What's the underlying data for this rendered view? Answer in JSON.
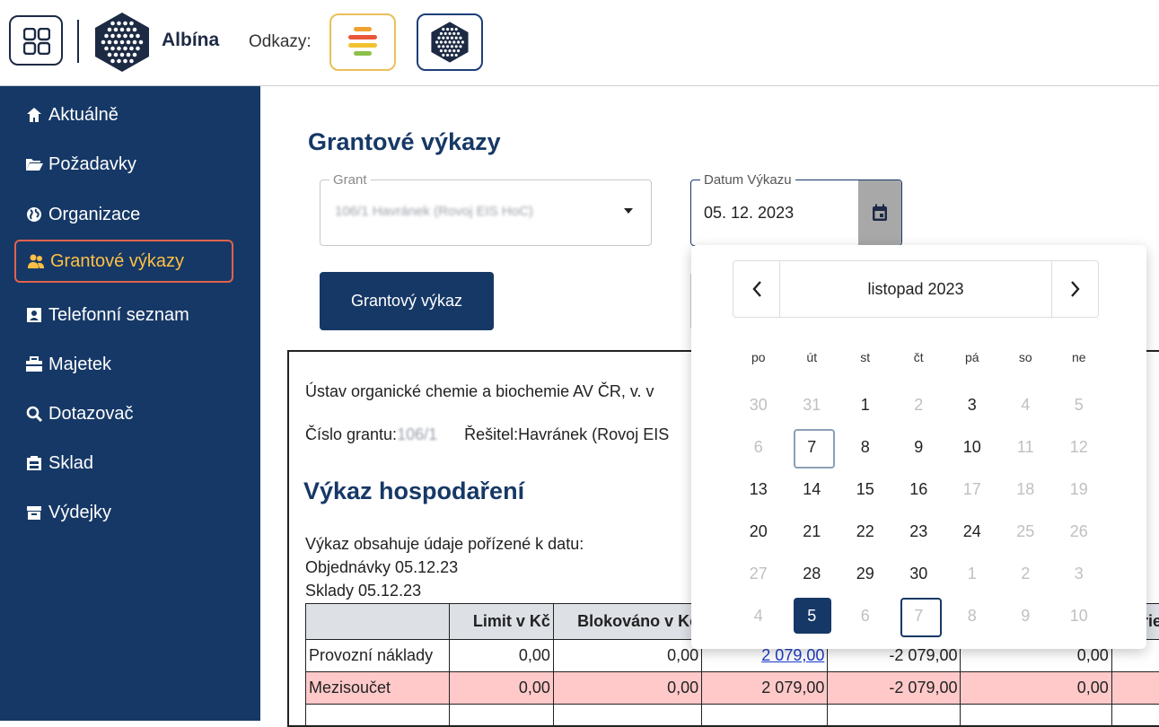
{
  "header": {
    "app_name": "Albína",
    "links_label": "Odkazy:"
  },
  "sidebar": {
    "items": [
      {
        "label": "Aktuálně",
        "icon": "home-icon"
      },
      {
        "label": "Požadavky",
        "icon": "folder-icon"
      },
      {
        "label": "Organizace",
        "icon": "globe-icon"
      },
      {
        "label": "Grantové výkazy",
        "icon": "users-icon"
      },
      {
        "label": "Telefonní seznam",
        "icon": "contact-card-icon"
      },
      {
        "label": "Majetek",
        "icon": "briefcase-icon"
      },
      {
        "label": "Dotazovač",
        "icon": "search-icon"
      },
      {
        "label": "Sklad",
        "icon": "warehouse-icon"
      },
      {
        "label": "Výdejky",
        "icon": "box-icon"
      }
    ],
    "active_index": 3
  },
  "main": {
    "title": "Grantové výkazy",
    "grant_field": {
      "legend": "Grant",
      "value": "106/1 Havránek (Rovoj EIS HoC)"
    },
    "date_field": {
      "legend": "Datum Výkazu",
      "value": "05. 12. 2023"
    },
    "grant_button_label": "Grantový výkaz"
  },
  "report": {
    "institution": "Ústav organické chemie a biochemie AV ČR, v. v",
    "grant_number_label": "Číslo grantu:",
    "grant_number_value": "106/1",
    "solver": "Řešitel:Havránek (Rovoj EIS",
    "heading": "Výkaz hospodaření",
    "note_line1": "Výkaz obsahuje údaje pořízené k datu:",
    "note_line2": "Objednávky 05.12.23",
    "note_line3": "Sklady 05.12.23",
    "columns": [
      "",
      "Limit v Kč",
      "Blokováno v Kč",
      "",
      "",
      "",
      "rie"
    ],
    "rows": [
      {
        "label": "Provozní náklady",
        "limit": "0,00",
        "blocked": "0,00",
        "c3": "2 079,00",
        "c4": "-2 079,00",
        "c5": "0,00"
      },
      {
        "label": "Mezisoučet",
        "limit": "0,00",
        "blocked": "0,00",
        "c3": "2 079,00",
        "c4": "-2 079,00",
        "c5": "0,00"
      }
    ]
  },
  "calendar": {
    "month_label": "listopad 2023",
    "prev_glyph": "‹",
    "next_glyph": "›",
    "weekdays": [
      "po",
      "út",
      "st",
      "čt",
      "pá",
      "so",
      "ne"
    ],
    "days": [
      {
        "d": "30",
        "muted": true
      },
      {
        "d": "31",
        "muted": true
      },
      {
        "d": "1"
      },
      {
        "d": "2",
        "muted": true
      },
      {
        "d": "3"
      },
      {
        "d": "4",
        "muted": true
      },
      {
        "d": "5",
        "muted": true
      },
      {
        "d": "6",
        "muted": true
      },
      {
        "d": "7",
        "today": true
      },
      {
        "d": "8"
      },
      {
        "d": "9"
      },
      {
        "d": "10"
      },
      {
        "d": "11",
        "muted": true
      },
      {
        "d": "12",
        "muted": true
      },
      {
        "d": "13"
      },
      {
        "d": "14"
      },
      {
        "d": "15"
      },
      {
        "d": "16"
      },
      {
        "d": "17",
        "muted": true
      },
      {
        "d": "18",
        "muted": true
      },
      {
        "d": "19",
        "muted": true
      },
      {
        "d": "20"
      },
      {
        "d": "21"
      },
      {
        "d": "22"
      },
      {
        "d": "23"
      },
      {
        "d": "24"
      },
      {
        "d": "25",
        "muted": true
      },
      {
        "d": "26",
        "muted": true
      },
      {
        "d": "27",
        "muted": true
      },
      {
        "d": "28"
      },
      {
        "d": "29"
      },
      {
        "d": "30"
      },
      {
        "d": "1",
        "muted": true
      },
      {
        "d": "2",
        "muted": true
      },
      {
        "d": "3",
        "muted": true
      },
      {
        "d": "4",
        "muted": true
      },
      {
        "d": "5",
        "selected": true
      },
      {
        "d": "6",
        "muted": true
      },
      {
        "d": "7",
        "muted": true,
        "focus": true
      },
      {
        "d": "8",
        "muted": true
      },
      {
        "d": "9",
        "muted": true
      },
      {
        "d": "10",
        "muted": true
      }
    ]
  },
  "colors": {
    "navy": "#163866",
    "active_border": "#e0634a",
    "active_text": "#ffc043",
    "subtotal_row": "#ffc9c9",
    "link": "#1a3ccc"
  }
}
